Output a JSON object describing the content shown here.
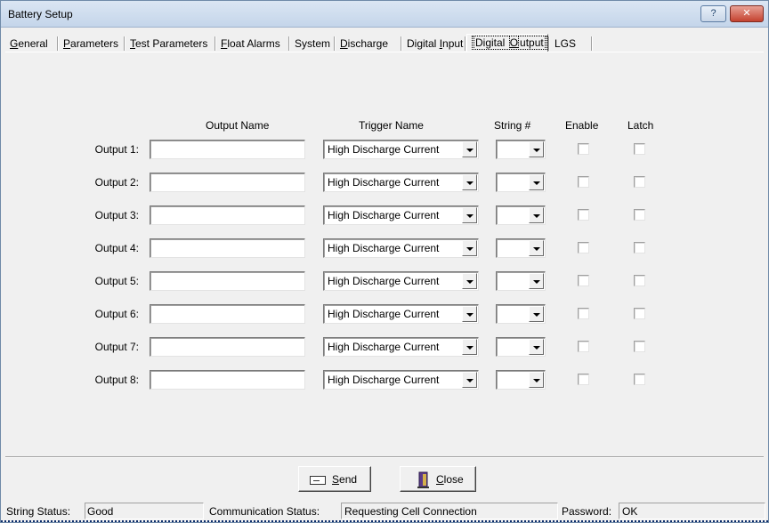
{
  "window": {
    "title": "Battery Setup",
    "help_label": "?",
    "close_label": "✕"
  },
  "tabs": [
    {
      "label": "General",
      "mnemonic": "G",
      "rest": "eneral"
    },
    {
      "label": "Parameters",
      "mnemonic": "P",
      "rest": "arameters"
    },
    {
      "label": "Test Parameters",
      "mnemonic": "T",
      "rest": "est Parameters"
    },
    {
      "label": "Float Alarms",
      "mnemonic": "F",
      "rest": "loat Alarms"
    },
    {
      "label": "System",
      "mnemonic": "",
      "rest": "System"
    },
    {
      "label": "Discharge",
      "mnemonic": "D",
      "rest": "ischarge"
    },
    {
      "label": "Digital Input",
      "pre": "Digital ",
      "mnemonic": "I",
      "rest": "nput"
    },
    {
      "label": "Digital Output",
      "pre": "Digital ",
      "mnemonic": "O",
      "rest": "utput"
    },
    {
      "label": "LGS",
      "mnemonic": "",
      "rest": "LGS"
    }
  ],
  "active_tab": "Digital Output",
  "columns": {
    "output_name": "Output Name",
    "trigger_name": "Trigger Name",
    "string": "String #",
    "enable": "Enable",
    "latch": "Latch"
  },
  "outputs": [
    {
      "label": "Output 1:",
      "name": "",
      "trigger": "High Discharge Current",
      "string": "",
      "enable": false,
      "latch": false
    },
    {
      "label": "Output 2:",
      "name": "",
      "trigger": "High Discharge Current",
      "string": "",
      "enable": false,
      "latch": false
    },
    {
      "label": "Output 3:",
      "name": "",
      "trigger": "High Discharge Current",
      "string": "",
      "enable": false,
      "latch": false
    },
    {
      "label": "Output 4:",
      "name": "",
      "trigger": "High Discharge Current",
      "string": "",
      "enable": false,
      "latch": false
    },
    {
      "label": "Output 5:",
      "name": "",
      "trigger": "High Discharge Current",
      "string": "",
      "enable": false,
      "latch": false
    },
    {
      "label": "Output 6:",
      "name": "",
      "trigger": "High Discharge Current",
      "string": "",
      "enable": false,
      "latch": false
    },
    {
      "label": "Output 7:",
      "name": "",
      "trigger": "High Discharge Current",
      "string": "",
      "enable": false,
      "latch": false
    },
    {
      "label": "Output 8:",
      "name": "",
      "trigger": "High Discharge Current",
      "string": "",
      "enable": false,
      "latch": false
    }
  ],
  "buttons": {
    "send": {
      "mnemonic": "S",
      "rest": "end"
    },
    "close": {
      "mnemonic": "C",
      "rest": "lose"
    }
  },
  "status": {
    "string_label": "String Status:",
    "string_value": "Good",
    "comm_label": "Communication Status:",
    "comm_value": "Requesting Cell Connection",
    "password_label": "Password:",
    "password_value": "OK"
  }
}
